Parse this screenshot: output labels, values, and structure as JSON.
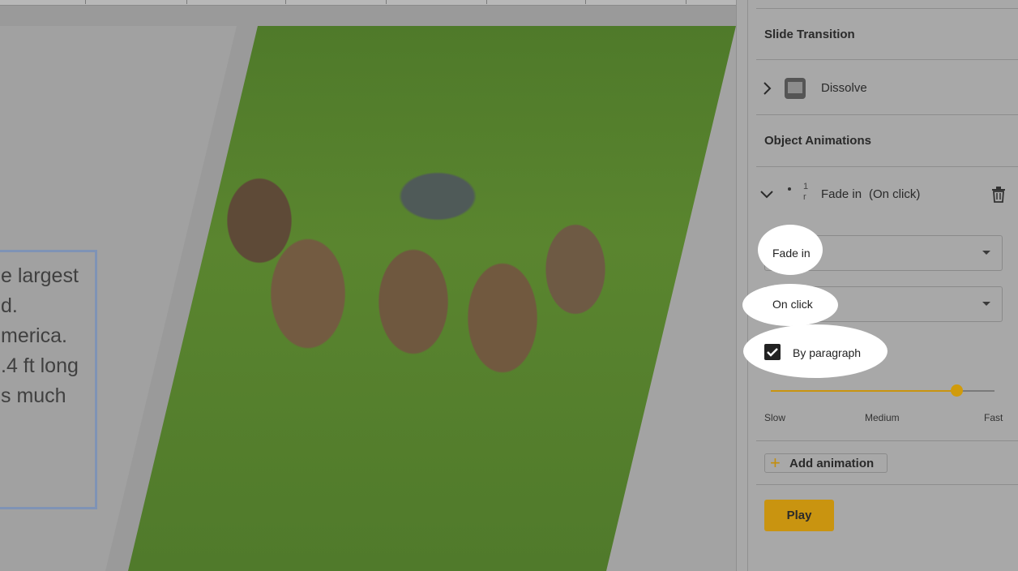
{
  "slide": {
    "text_lines": [
      "e largest",
      "d.",
      "merica.",
      ".4 ft long",
      "s much"
    ]
  },
  "panel": {
    "slide_transition": {
      "title": "Slide Transition",
      "transition_name": "Dissolve"
    },
    "object_animations": {
      "title": "Object Animations",
      "item": {
        "order_marker": "1\nr",
        "label": "Fade in",
        "trigger_label": "(On click)"
      },
      "effect_dropdown": {
        "value": "Fade in"
      },
      "start_dropdown": {
        "value": "On click"
      },
      "by_paragraph": {
        "label": "By paragraph",
        "checked": true
      },
      "speed": {
        "value_fraction": 0.83,
        "labels": {
          "slow": "Slow",
          "medium": "Medium",
          "fast": "Fast"
        }
      },
      "add_animation_label": "Add animation"
    },
    "play_label": "Play"
  },
  "colors": {
    "accent": "#c99410",
    "highlight": "#ffffff",
    "overlay_gray": "#a8a8a8"
  },
  "icons": [
    "chevron-right-icon",
    "transition-thumbnail-icon",
    "chevron-down-icon",
    "drag-handle-icon",
    "trash-icon",
    "checkmark-icon",
    "plus-icon"
  ]
}
